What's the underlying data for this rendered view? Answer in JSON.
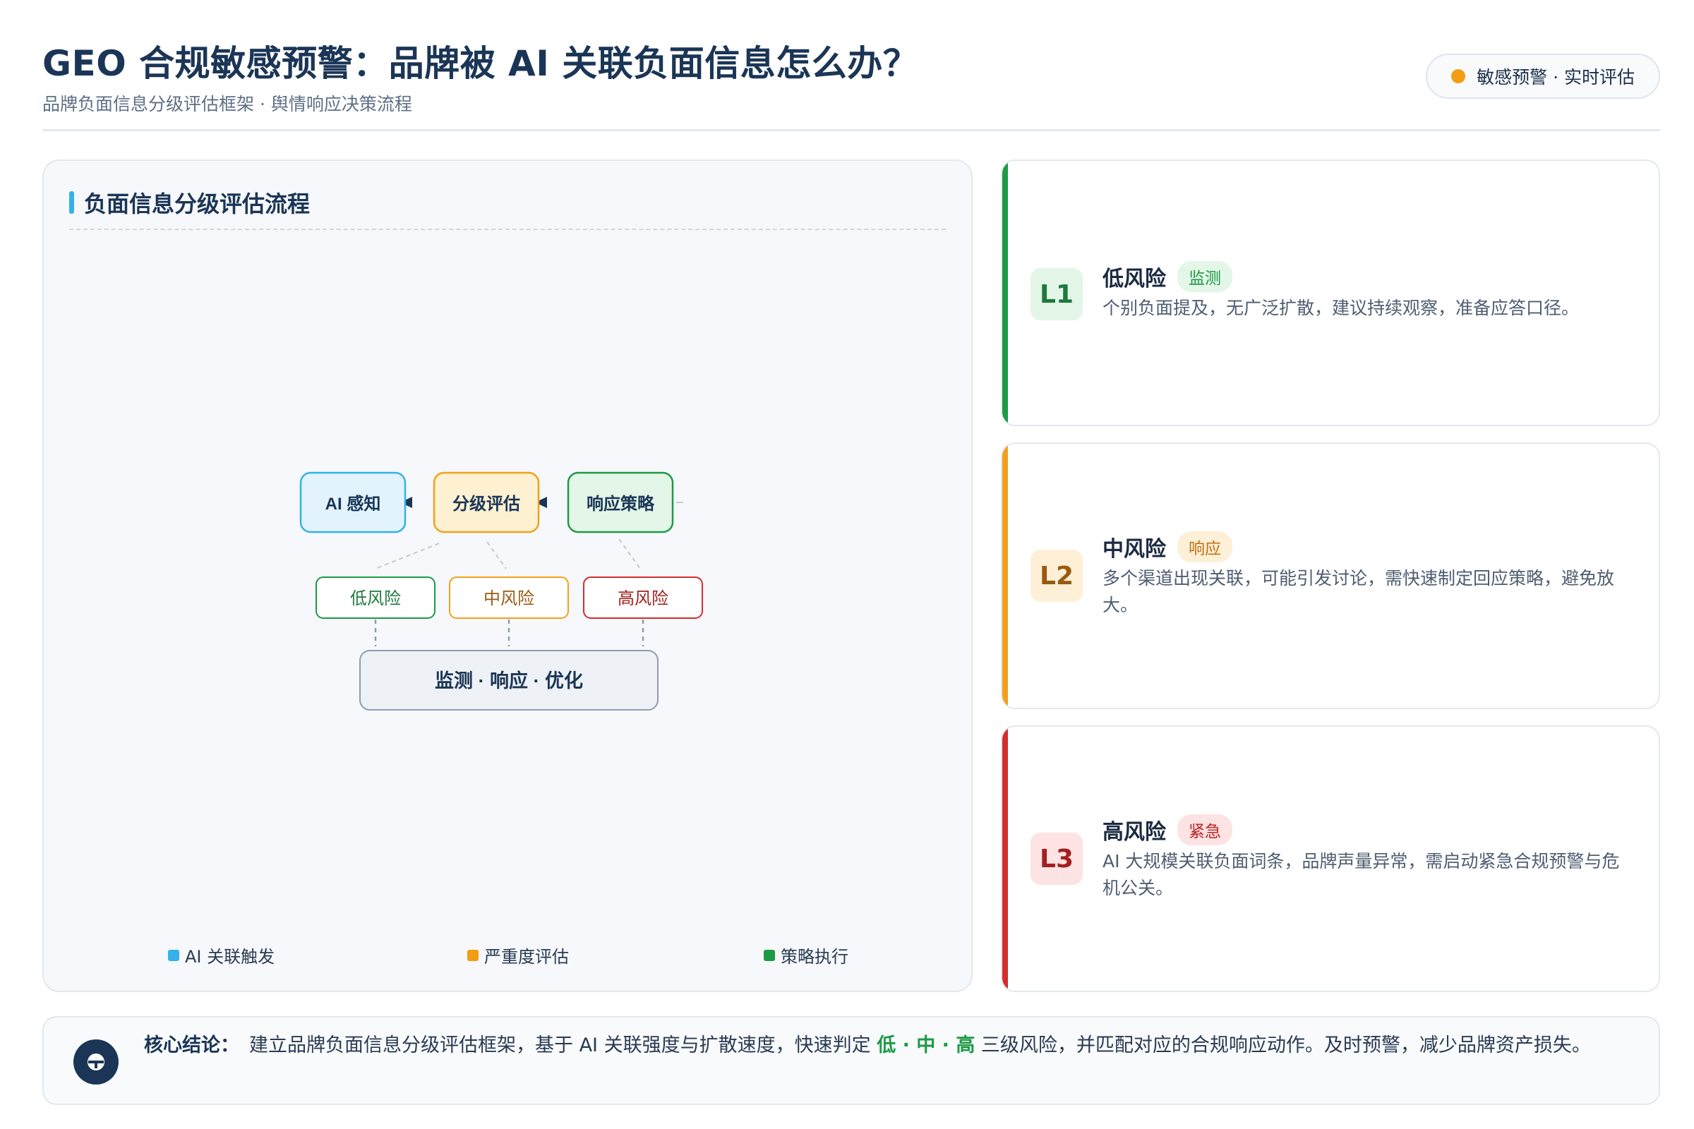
{
  "header": {
    "title": "GEO 合规敏感预警：品牌被 AI 关联负面信息怎么办？",
    "subtitle": "品牌负面信息分级评估框架 · 舆情响应决策流程",
    "badge": "敏感预警 · 实时评估",
    "badge_dot_color": "#f29d12"
  },
  "diagram": {
    "title": "负面信息分级评估流程",
    "nodes": {
      "sense": "AI 感知",
      "assess": "分级评估",
      "strategy": "响应策略"
    },
    "risks": {
      "low": "低风险",
      "mid": "中风险",
      "high": "高风险"
    },
    "bottom": "监测 · 响应 · 优化",
    "legend": [
      {
        "label": "AI 关联触发",
        "color": "#33b1ea"
      },
      {
        "label": "严重度评估",
        "color": "#f29d12"
      },
      {
        "label": "策略执行",
        "color": "#1d9a45"
      }
    ]
  },
  "levels": [
    {
      "code": "L1",
      "name": "低风险",
      "tag": "监测",
      "desc": "个别负面提及，无广泛扩散，建议持续观察，准备应答口径。",
      "color": "#1d9a45",
      "tag_bg": "#e3f6e8"
    },
    {
      "code": "L2",
      "name": "中风险",
      "tag": "响应",
      "desc": "多个渠道出现关联，可能引发讨论，需快速制定回应策略，避免放大。",
      "color": "#f2a01c",
      "tag_bg": "#fdf0d6"
    },
    {
      "code": "L3",
      "name": "高风险",
      "tag": "紧急",
      "desc": "AI 大规模关联负面词条，品牌声量异常，需启动紧急合规预警与危机公关。",
      "color": "#d42d2d",
      "tag_bg": "#fde3e3"
    }
  ],
  "conclusion": {
    "label": "核心结论：",
    "text_before": "建立品牌负面信息分级评估框架，基于 AI 关联强度与扩散速度，快速判定",
    "levels_text": "低 · 中 · 高",
    "text_after": "三级风险，并匹配对应的合规响应动作。及时预警，减少品牌资产损失。"
  }
}
